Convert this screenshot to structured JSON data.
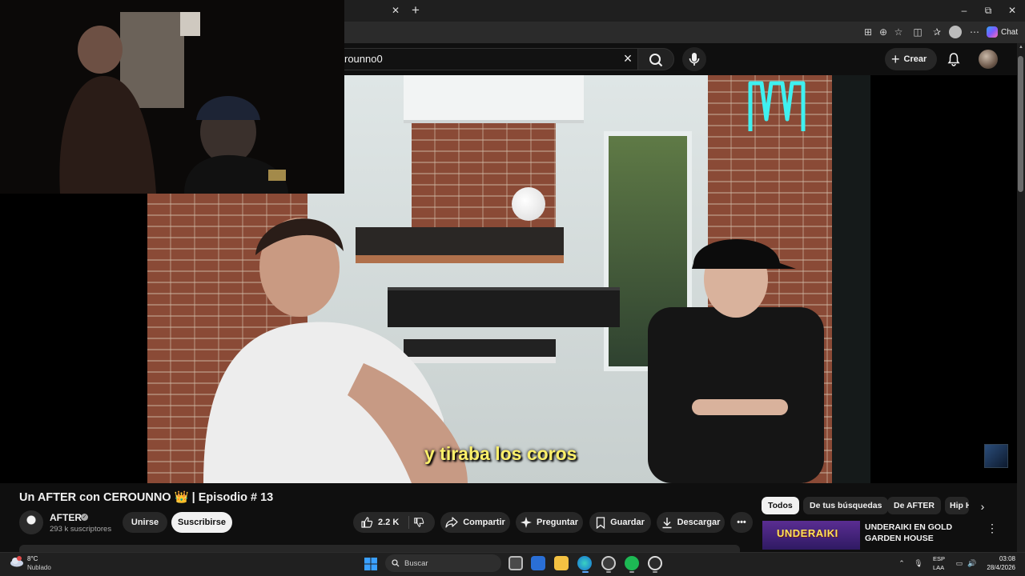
{
  "browser": {
    "chat_label": "Chat",
    "window_controls": {
      "minimize": "–",
      "maximize": "⧉",
      "close": "✕"
    }
  },
  "header": {
    "search_value": "rounno0",
    "create_label": "Crear",
    "icons": [
      "search-icon",
      "mic-icon",
      "bell-icon",
      "user-avatar"
    ]
  },
  "video": {
    "subtitle": "y tiraba los coros"
  },
  "info": {
    "title": "Un AFTER con CEROUNNO 👑 | Episodio # 13",
    "channel_name": "AFTER",
    "subscribers": "293 k suscriptores",
    "join_label": "Unirse",
    "subscribe_label": "Suscribirse",
    "like_count": "2.2 K",
    "share_label": "Compartir",
    "ask_label": "Preguntar",
    "save_label": "Guardar",
    "download_label": "Descargar",
    "more_label": "•••"
  },
  "sidebar": {
    "chips": [
      "Todos",
      "De tus búsquedas",
      "De AFTER",
      "Hip Hop"
    ],
    "recommendation": {
      "thumb_text": "UNDERAIKI",
      "title": "UNDERAIKI EN GOLD GARDEN HOUSE"
    }
  },
  "taskbar": {
    "weather_temp": "8°C",
    "weather_desc": "Nublado",
    "search_label": "Buscar",
    "lang_top": "ESP",
    "lang_bottom": "LAA",
    "time": "03:08",
    "date": "28/4/2026"
  },
  "colors": {
    "background": "#0f0f0f",
    "chip_bg": "#272727",
    "subtitle": "#fdf06a",
    "neon": "#3ff0f0"
  }
}
